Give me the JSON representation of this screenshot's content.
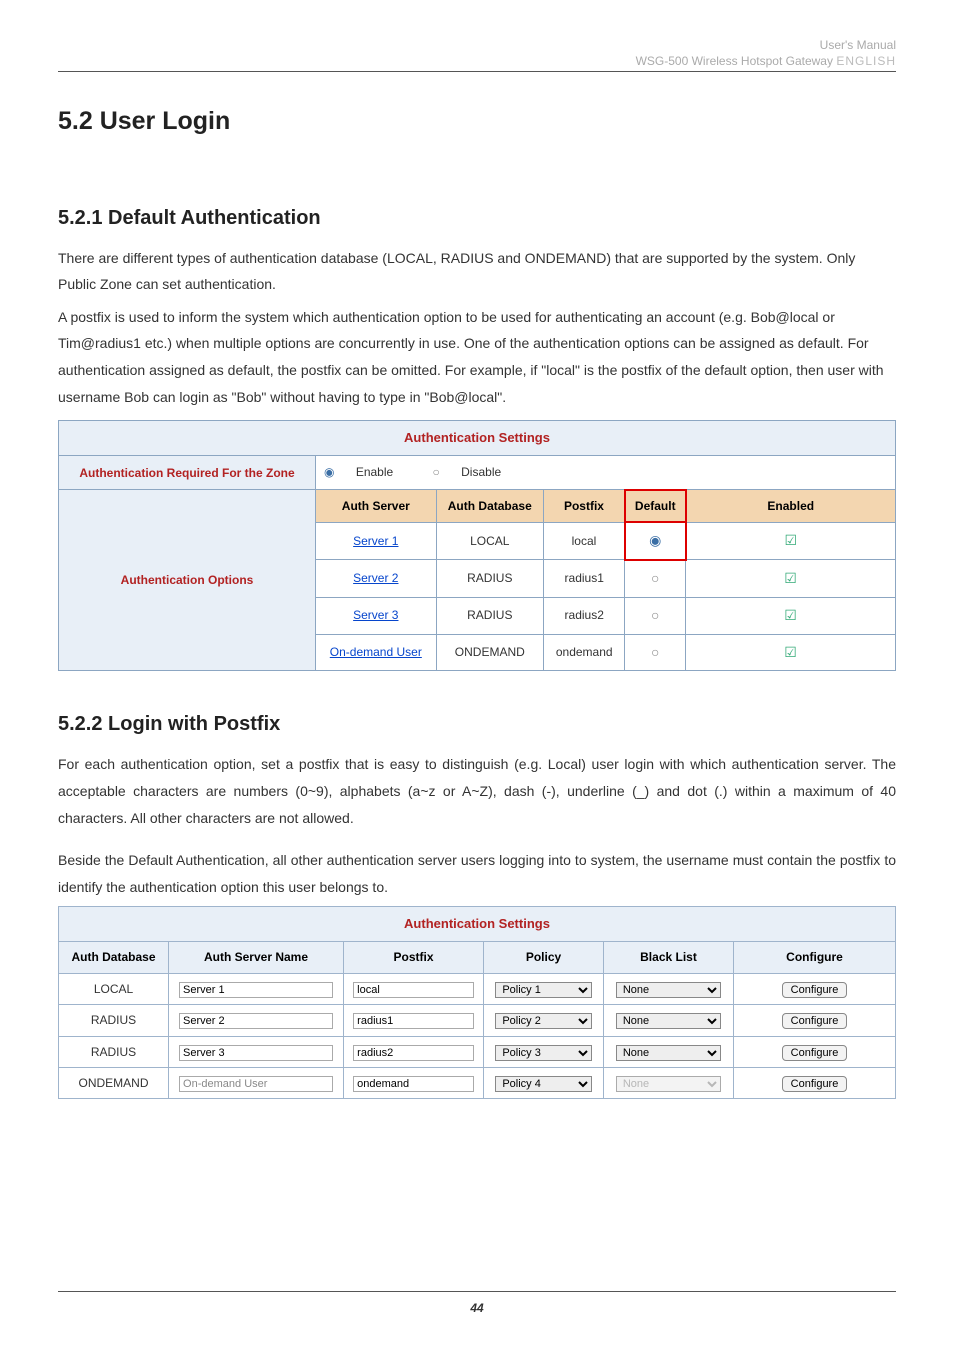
{
  "header": {
    "line1": "User's Manual",
    "line2_prefix": "WSG-500 Wireless Hotspot Gateway ",
    "line2_lang": "ENGLISH"
  },
  "h1": "5.2  User Login",
  "s521": {
    "heading": "5.2.1  Default Authentication",
    "para1": "There are different types of authentication database (LOCAL, RADIUS and ONDEMAND) that are supported by the system. Only Public Zone can set authentication.",
    "para2": "A postfix is used to inform the system which authentication option to be used for authenticating an account (e.g. Bob@local or Tim@radius1 etc.) when multiple options are concurrently in use. One of the authentication options can be assigned as default. For authentication assigned as default, the postfix can be omitted. For example, if \"local\" is the postfix of the default option, then user with username Bob can login as \"Bob\" without having to type in \"Bob@local\"."
  },
  "table1": {
    "title": "Authentication Settings",
    "row_label_zone": "Authentication Required For the Zone",
    "enable_label": "Enable",
    "disable_label": "Disable",
    "row_label_opts": "Authentication Options",
    "cols": {
      "auth_server": "Auth Server",
      "auth_db": "Auth Database",
      "postfix": "Postfix",
      "default": "Default",
      "enabled": "Enabled"
    },
    "rows": [
      {
        "server": "Server 1",
        "db": "LOCAL",
        "postfix": "local",
        "default": true
      },
      {
        "server": "Server 2",
        "db": "RADIUS",
        "postfix": "radius1",
        "default": false
      },
      {
        "server": "Server 3",
        "db": "RADIUS",
        "postfix": "radius2",
        "default": false
      },
      {
        "server": "On-demand User",
        "db": "ONDEMAND",
        "postfix": "ondemand",
        "default": false
      }
    ]
  },
  "s522": {
    "heading": "5.2.2  Login with Postfix",
    "para1": "For each authentication option, set a postfix that is easy to distinguish (e.g. Local) user login with which authentication server. The acceptable characters are numbers (0~9), alphabets (a~z or A~Z), dash (-), underline (_) and dot (.) within a maximum of 40 characters. All other characters are not allowed.",
    "para2": "Beside the Default Authentication, all other authentication server users logging into to system, the username must contain the postfix to identify the authentication option this user belongs to."
  },
  "table2": {
    "title": "Authentication Settings",
    "cols": {
      "db": "Auth Database",
      "server_name": "Auth Server Name",
      "postfix": "Postfix",
      "policy": "Policy",
      "black_list": "Black List",
      "configure": "Configure"
    },
    "rows": [
      {
        "db": "LOCAL",
        "server": "Server 1",
        "postfix": "local",
        "policy": "Policy 1",
        "blacklist": "None",
        "disabled": false
      },
      {
        "db": "RADIUS",
        "server": "Server 2",
        "postfix": "radius1",
        "policy": "Policy 2",
        "blacklist": "None",
        "disabled": false
      },
      {
        "db": "RADIUS",
        "server": "Server 3",
        "postfix": "radius2",
        "policy": "Policy 3",
        "blacklist": "None",
        "disabled": false
      },
      {
        "db": "ONDEMAND",
        "server": "On-demand User",
        "postfix": "ondemand",
        "policy": "Policy 4",
        "blacklist": "None",
        "disabled": true
      }
    ],
    "configure_label": "Configure"
  },
  "page_number": "44"
}
